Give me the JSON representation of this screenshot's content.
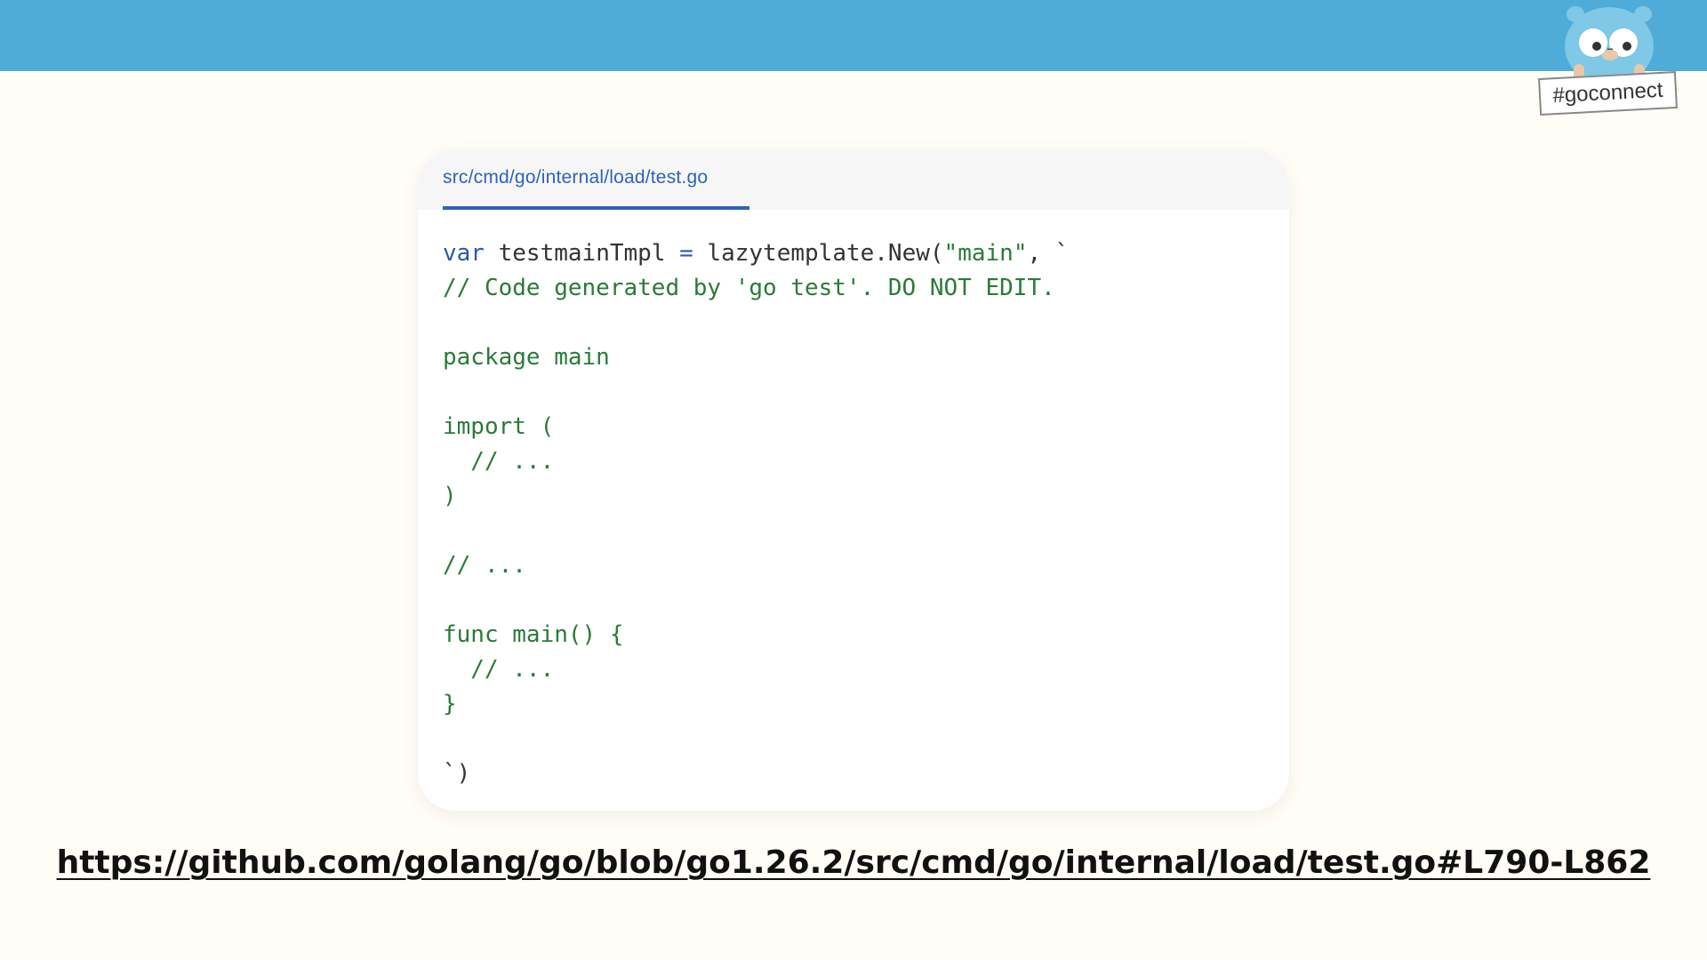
{
  "file_tab": {
    "path": "src/cmd/go/internal/load/test.go"
  },
  "code": {
    "line1": {
      "kw_var": "var",
      "name": " testmainTmpl ",
      "op": "=",
      "call": " lazytemplate.New(",
      "str": "\"main\"",
      "rest": ", `"
    },
    "line2": "// Code generated by 'go test'. DO NOT EDIT.",
    "line4": "package main",
    "line6": "import (",
    "line7": "  // ...",
    "line8": ")",
    "line10": "// ...",
    "line12": "func main() {",
    "line13": "  // ...",
    "line14": "}",
    "line16": "`)"
  },
  "link": {
    "url": "https://github.com/golang/go/blob/go1.26.2/src/cmd/go/internal/load/test.go#L790-L862"
  },
  "badge": {
    "hashtag": "#goconnect"
  },
  "colors": {
    "banner": "#4fabd7",
    "background": "#fffdf6",
    "keyword": "#2a5aa8",
    "template_text": "#2a7b38",
    "tab_accent": "#2f63b8"
  },
  "icons": {
    "mascot": "gopher-mascot-icon"
  }
}
